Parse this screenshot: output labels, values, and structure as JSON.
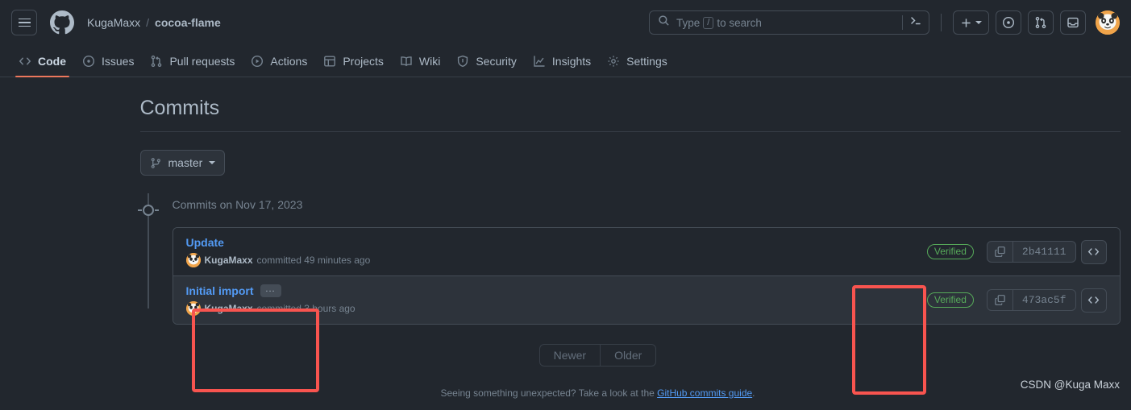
{
  "header": {
    "menu_icon": "hamburger-icon",
    "logo_icon": "github-logo-icon",
    "owner": "KugaMaxx",
    "separator": "/",
    "repo": "cocoa-flame",
    "search": {
      "icon": "search-icon",
      "placeholder_prefix": "Type",
      "placeholder_key": "/",
      "placeholder_suffix": "to search",
      "terminal_icon": "command-palette-icon"
    },
    "create_button": {
      "icon": "plus-icon",
      "caret": "chevron-down-icon"
    },
    "issues_icon": "issue-opened-icon",
    "pull_requests_icon": "git-pull-request-icon",
    "inbox_icon": "inbox-icon",
    "avatar": "user-avatar"
  },
  "nav": {
    "items": [
      {
        "label": "Code",
        "icon": "code-icon",
        "active": true
      },
      {
        "label": "Issues",
        "icon": "issue-opened-icon",
        "active": false
      },
      {
        "label": "Pull requests",
        "icon": "git-pull-request-icon",
        "active": false
      },
      {
        "label": "Actions",
        "icon": "play-icon",
        "active": false
      },
      {
        "label": "Projects",
        "icon": "table-icon",
        "active": false
      },
      {
        "label": "Wiki",
        "icon": "book-icon",
        "active": false
      },
      {
        "label": "Security",
        "icon": "shield-icon",
        "active": false
      },
      {
        "label": "Insights",
        "icon": "graph-icon",
        "active": false
      },
      {
        "label": "Settings",
        "icon": "gear-icon",
        "active": false
      }
    ]
  },
  "main": {
    "page_title": "Commits",
    "branch": {
      "icon": "git-branch-icon",
      "name": "master",
      "caret": "chevron-down-icon"
    },
    "commits_group_date": "Commits on Nov 17, 2023",
    "commits": [
      {
        "title": "Update",
        "has_ellipsis": false,
        "ellipsis_label": "",
        "author": "KugaMaxx",
        "committed_text": "committed 49 minutes ago",
        "verified_label": "Verified",
        "sha": "2b41111",
        "copy_icon": "copy-icon",
        "code_icon": "code-view-icon"
      },
      {
        "title": "Initial import",
        "has_ellipsis": true,
        "ellipsis_label": "...",
        "author": "KugaMaxx",
        "committed_text": "committed 3 hours ago",
        "verified_label": "Verified",
        "sha": "473ac5f",
        "copy_icon": "copy-icon",
        "code_icon": "code-view-icon"
      }
    ],
    "pagination": {
      "newer": "Newer",
      "older": "Older"
    },
    "footnote": {
      "text_before": "Seeing something unexpected? Take a look at the ",
      "link": "GitHub commits guide",
      "text_after": "."
    }
  },
  "watermark": "CSDN @Kuga Maxx",
  "colors": {
    "page_bg": "#22272e",
    "surface": "#2d333b",
    "border": "#444c56",
    "text": "#adbac7",
    "muted": "#768390",
    "link": "#539bf5",
    "verified_green": "#57ab5a",
    "accent_underline": "#ec775c",
    "annotation_red": "#f8544f"
  }
}
